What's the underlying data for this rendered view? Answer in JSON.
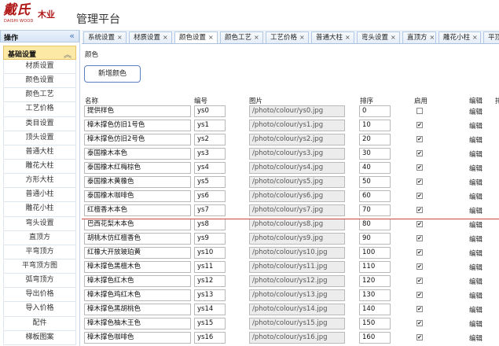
{
  "brand": {
    "mark": "戴氏",
    "tail": "木业",
    "sub": "DAISHI WOOD"
  },
  "app_title": "管理平台",
  "sidebar": {
    "header": "操作",
    "group": "基础设置",
    "items": [
      "材质设置",
      "颜色设置",
      "颜色工艺",
      "工艺价格",
      "类目设置",
      "顶头设置",
      "普通大柱",
      "雕花大柱",
      "方形大柱",
      "普通小柱",
      "雕花小柱",
      "弯头设置",
      "直顶方",
      "平弯顶方",
      "平弯顶方图",
      "弧弯顶方",
      "导出价格",
      "导入价格",
      "配件",
      "梯板图案"
    ]
  },
  "tabs": [
    "系统设置",
    "材质设置",
    "颜色设置",
    "颜色工艺",
    "工艺价格",
    "普通大柱",
    "弯头设置",
    "直顶方",
    "雕花小柱",
    "平顶"
  ],
  "active_tab": 2,
  "section_label": "颜色",
  "add_button": "新增颜色",
  "columns": {
    "name": "名称",
    "code": "编号",
    "image": "图片",
    "sort": "排序",
    "enabled": "启用",
    "edit": "编辑",
    "extra": "排"
  },
  "rows": [
    {
      "name": "提供样色",
      "code": "ys0",
      "image": "/photo/colour/ys0.jpg",
      "sort": "0",
      "enabled": false,
      "edit": "编辑"
    },
    {
      "name": "樟木撑色仿旧1号色",
      "code": "ys1",
      "image": "/photo/colour/ys1.jpg",
      "sort": "10",
      "enabled": true,
      "edit": "编辑"
    },
    {
      "name": "樟木撑色仿旧2号色",
      "code": "ys2",
      "image": "/photo/colour/ys2.jpg",
      "sort": "20",
      "enabled": true,
      "edit": "编辑"
    },
    {
      "name": "泰国橡木本色",
      "code": "ys3",
      "image": "/photo/colour/ys3.jpg",
      "sort": "30",
      "enabled": true,
      "edit": "编辑"
    },
    {
      "name": "泰国橡木红梅棕色",
      "code": "ys4",
      "image": "/photo/colour/ys4.jpg",
      "sort": "40",
      "enabled": true,
      "edit": "编辑"
    },
    {
      "name": "泰国橡木黄橡色",
      "code": "ys5",
      "image": "/photo/colour/ys5.jpg",
      "sort": "50",
      "enabled": true,
      "edit": "编辑"
    },
    {
      "name": "泰国橡木咖啡色",
      "code": "ys6",
      "image": "/photo/colour/ys6.jpg",
      "sort": "60",
      "enabled": true,
      "edit": "编辑"
    },
    {
      "name": "红檀香木本色",
      "code": "ys7",
      "image": "/photo/colour/ys7.jpg",
      "sort": "70",
      "enabled": true,
      "edit": "编辑"
    },
    {
      "name": "巴西花梨木本色",
      "code": "ys8",
      "image": "/photo/colour/ys8.jpg",
      "sort": "80",
      "enabled": true,
      "edit": "编辑"
    },
    {
      "name": "胡桃木仿红檀香色",
      "code": "ys9",
      "image": "/photo/colour/ys9.jpg",
      "sort": "90",
      "enabled": true,
      "edit": "编辑"
    },
    {
      "name": "红橡大开放玻珀黄",
      "code": "ys10",
      "image": "/photo/colour/ys10.jpg",
      "sort": "100",
      "enabled": true,
      "edit": "编辑"
    },
    {
      "name": "樟木撑色黑檀木色",
      "code": "ys11",
      "image": "/photo/colour/ys11.jpg",
      "sort": "110",
      "enabled": true,
      "edit": "编辑"
    },
    {
      "name": "樟木撑色红木色",
      "code": "ys12",
      "image": "/photo/colour/ys12.jpg",
      "sort": "120",
      "enabled": true,
      "edit": "编辑"
    },
    {
      "name": "樟木撑色鸡红木色",
      "code": "ys13",
      "image": "/photo/colour/ys13.jpg",
      "sort": "130",
      "enabled": true,
      "edit": "编辑"
    },
    {
      "name": "樟木撑色黑胡桃色",
      "code": "ys14",
      "image": "/photo/colour/ys14.jpg",
      "sort": "140",
      "enabled": true,
      "edit": "编辑"
    },
    {
      "name": "樟木撑色柚木王色",
      "code": "ys15",
      "image": "/photo/colour/ys15.jpg",
      "sort": "150",
      "enabled": true,
      "edit": "编辑"
    },
    {
      "name": "樟木撑色咖啡色",
      "code": "ys16",
      "image": "/photo/colour/ys16.jpg",
      "sort": "160",
      "enabled": true,
      "edit": "编辑"
    }
  ]
}
